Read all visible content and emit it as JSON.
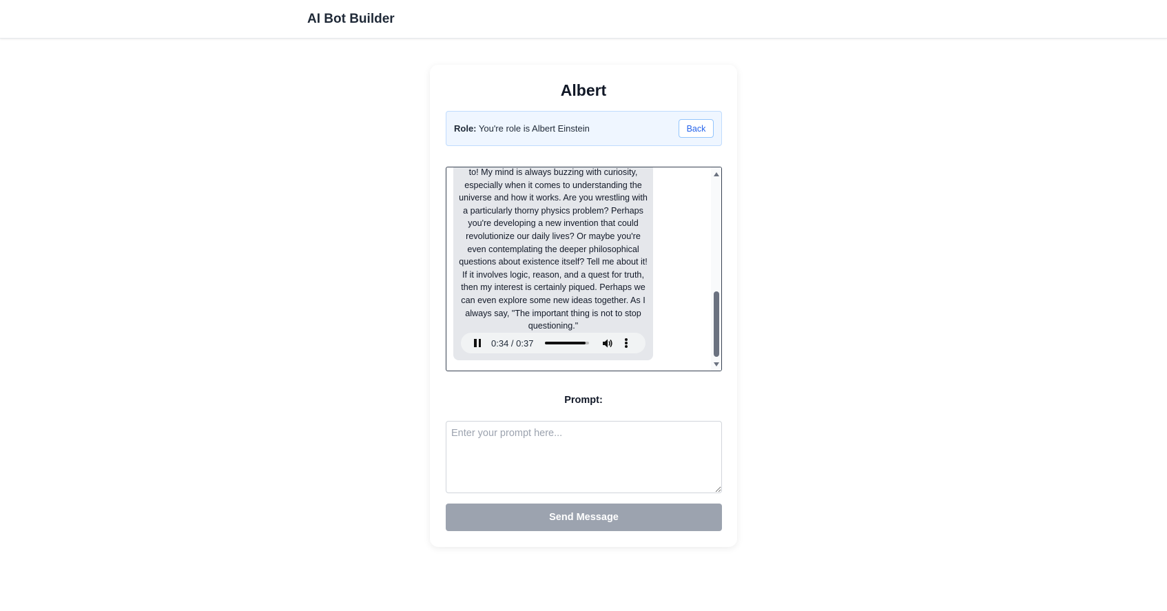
{
  "app": {
    "title": "AI Bot Builder"
  },
  "bot": {
    "name": "Albert",
    "role_label": "Role:",
    "role_value": "You're role is Albert Einstein",
    "back_label": "Back"
  },
  "chat": {
    "messages": [
      {
        "sender": "bot",
        "text": "to! My mind is always buzzing with curiosity, especially when it comes to understanding the universe and how it works. Are you wrestling with a particularly thorny physics problem? Perhaps you're developing a new invention that could revolutionize our daily lives? Or maybe you're even contemplating the deeper philosophical questions about existence itself? Tell me about it! If it involves logic, reason, and a quest for truth, then my interest is certainly piqued. Perhaps we can even explore some new ideas together. As I always say, \"The important thing is not to stop questioning.\"",
        "audio": {
          "time_display": "0:34 / 0:37",
          "progress": 0.92,
          "state": "playing",
          "icons": [
            "pause-icon",
            "volume-icon",
            "more-options-icon"
          ]
        }
      }
    ],
    "scroll_position": 1.0
  },
  "prompt": {
    "label": "Prompt:",
    "placeholder": "Enter your prompt here...",
    "value": "",
    "send_label": "Send Message",
    "send_enabled": false
  },
  "colors": {
    "role_bg": "#eff6ff",
    "role_border": "#bfdbfe",
    "back_text": "#2563eb",
    "bubble_bg": "#e5e7eb",
    "send_disabled": "#9ca3af"
  }
}
